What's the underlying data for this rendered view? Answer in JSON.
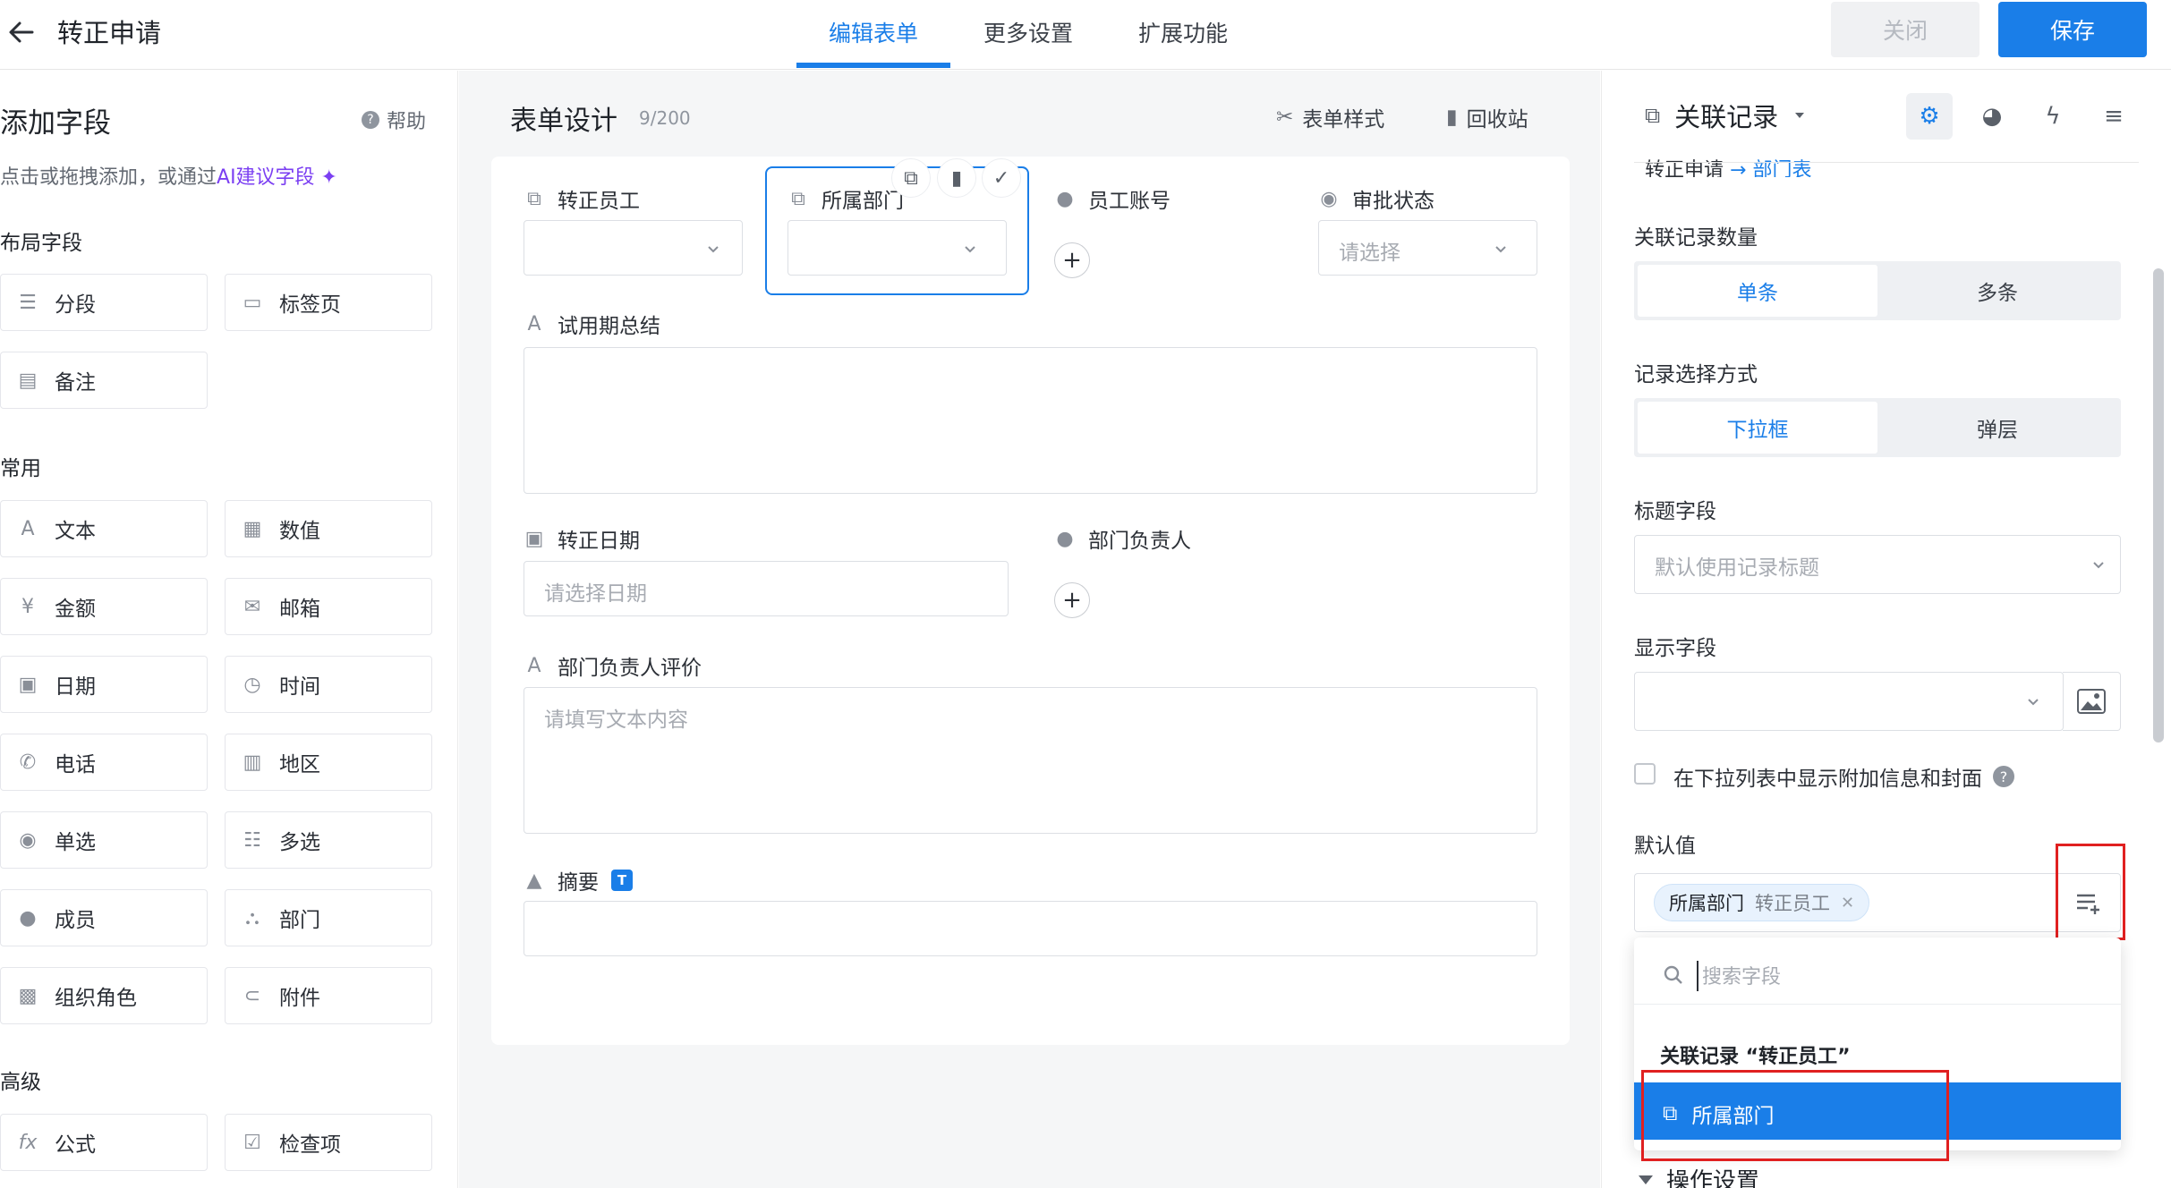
{
  "header": {
    "title": "转正申请",
    "tabs": [
      "编辑表单",
      "更多设置",
      "扩展功能"
    ],
    "close_label": "关闭",
    "save_label": "保存"
  },
  "left": {
    "title": "添加字段",
    "help": "帮助",
    "desc_prefix": "点击或拖拽添加，或通过",
    "desc_ai": "AI建议字段",
    "sections": {
      "layout": "布局字段",
      "common": "常用",
      "advanced": "高级"
    },
    "layout_fields": [
      "分段",
      "标签页",
      "备注"
    ],
    "common_fields": [
      "文本",
      "数值",
      "金额",
      "邮箱",
      "日期",
      "时间",
      "电话",
      "地区",
      "单选",
      "多选",
      "成员",
      "部门",
      "组织角色",
      "附件"
    ],
    "advanced_fields": [
      "公式",
      "检查项"
    ]
  },
  "center": {
    "title": "表单设计",
    "count": "9/200",
    "style_label": "表单样式",
    "bin_label": "回收站",
    "fields": {
      "employee": "转正员工",
      "dept": "所属部门",
      "account": "员工账号",
      "approval": "审批状态",
      "approval_placeholder": "请选择",
      "summary_trial": "试用期总结",
      "date": "转正日期",
      "date_placeholder": "请选择日期",
      "dept_head": "部门负责人",
      "dept_head_eval": "部门负责人评价",
      "eval_placeholder": "请填写文本内容",
      "abstract": "摘要",
      "abstract_badge": "T"
    }
  },
  "right": {
    "header": "关联记录",
    "crumb_from": "转正申请",
    "crumb_arrow": "→",
    "crumb_to": "部门表",
    "count_label": "关联记录数量",
    "count_options": [
      "单条",
      "多条"
    ],
    "select_mode_label": "记录选择方式",
    "select_mode_options": [
      "下拉框",
      "弹层"
    ],
    "title_field_label": "标题字段",
    "title_field_placeholder": "默认使用记录标题",
    "display_field_label": "显示字段",
    "extra_info_label": "在下拉列表中显示附加信息和封面",
    "default_label": "默认值",
    "tag_primary": "所属部门",
    "tag_secondary": "转正员工",
    "search_placeholder": "搜索字段",
    "dropdown_group": "关联记录 “转正员工”",
    "dropdown_item": "所属部门",
    "action_settings": "操作设置"
  },
  "colors": {
    "accent": "#1a7ee8",
    "ai": "#7b3ff2",
    "highlight_red": "#e02020"
  }
}
